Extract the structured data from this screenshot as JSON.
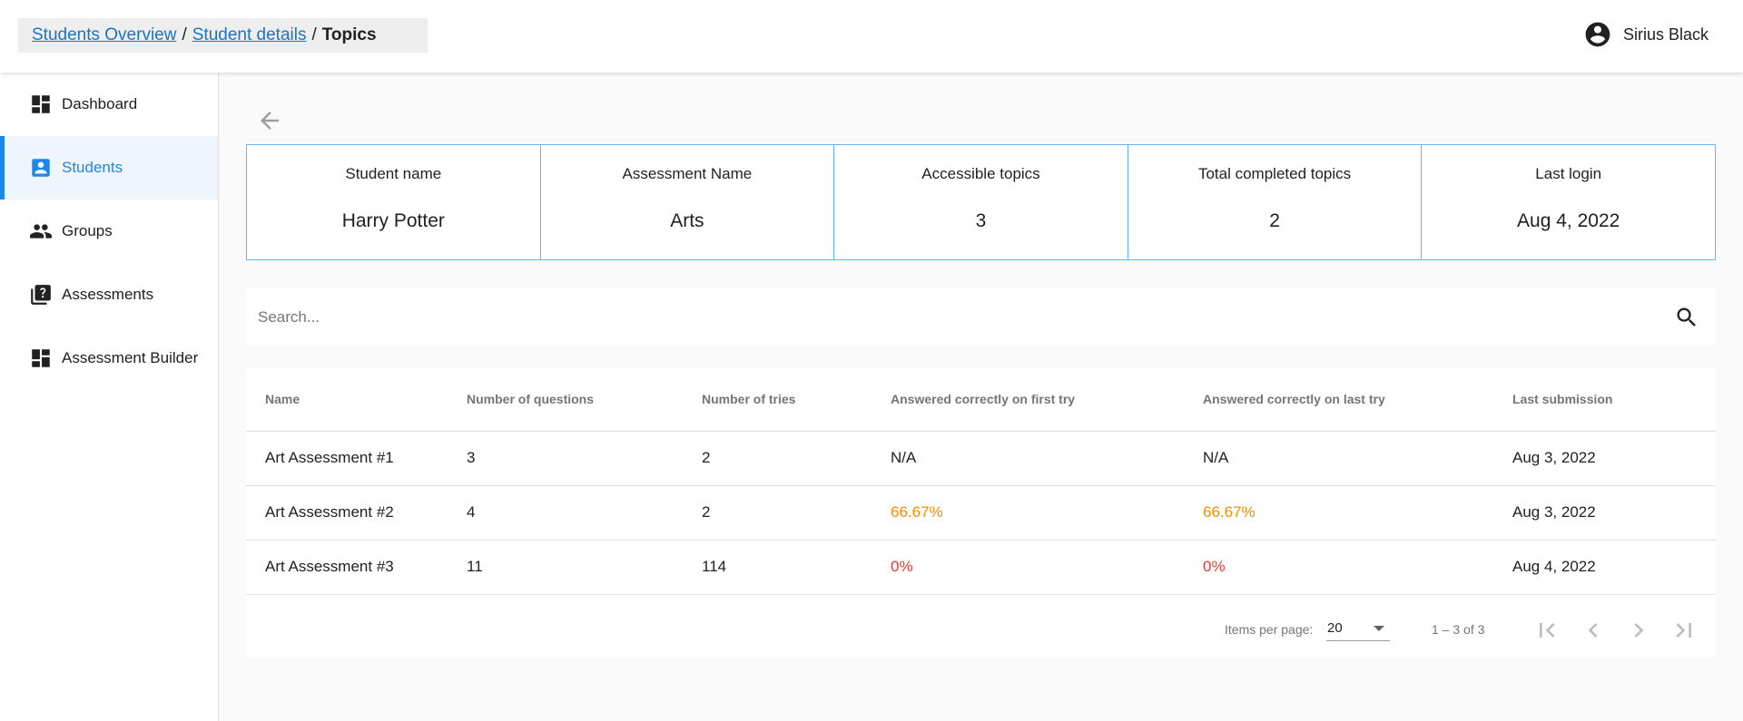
{
  "breadcrumb": {
    "items": [
      "Students Overview",
      "Student details"
    ],
    "separator": "/",
    "current": "Topics"
  },
  "user": {
    "name": "Sirius Black",
    "icon": "account-circle-icon"
  },
  "sidebar": {
    "items": [
      {
        "label": "Dashboard",
        "icon": "dashboard-icon",
        "active": false
      },
      {
        "label": "Students",
        "icon": "student-badge-icon",
        "active": true
      },
      {
        "label": "Groups",
        "icon": "groups-icon",
        "active": false
      },
      {
        "label": "Assessments",
        "icon": "quiz-icon",
        "active": false
      },
      {
        "label": "Assessment Builder",
        "icon": "dashboard-icon",
        "active": false
      }
    ]
  },
  "summary": [
    {
      "label": "Student name",
      "value": "Harry Potter"
    },
    {
      "label": "Assessment Name",
      "value": "Arts"
    },
    {
      "label": "Accessible topics",
      "value": "3"
    },
    {
      "label": "Total completed topics",
      "value": "2"
    },
    {
      "label": "Last login",
      "value": "Aug 4, 2022"
    }
  ],
  "search": {
    "placeholder": "Search...",
    "value": ""
  },
  "table": {
    "columns": [
      "Name",
      "Number of questions",
      "Number of tries",
      "Answered correctly on first try",
      "Answered correctly on last try",
      "Last submission"
    ],
    "rows": [
      [
        "Art Assessment #1",
        "3",
        "2",
        "N/A",
        "N/A",
        "Aug 3, 2022"
      ],
      [
        "Art Assessment #2",
        "4",
        "2",
        "66.67%",
        "66.67%",
        "Aug 3, 2022"
      ],
      [
        "Art Assessment #3",
        "11",
        "114",
        "0%",
        "0%",
        "Aug 4, 2022"
      ]
    ]
  },
  "paginator": {
    "items_per_page_label": "Items per page:",
    "items_per_page": "20",
    "range": "1 – 3 of 3"
  },
  "colors": {
    "accent": "#1e88e5",
    "warning": "#fb8c00",
    "error": "#e53935",
    "border": "#64b5f6"
  }
}
